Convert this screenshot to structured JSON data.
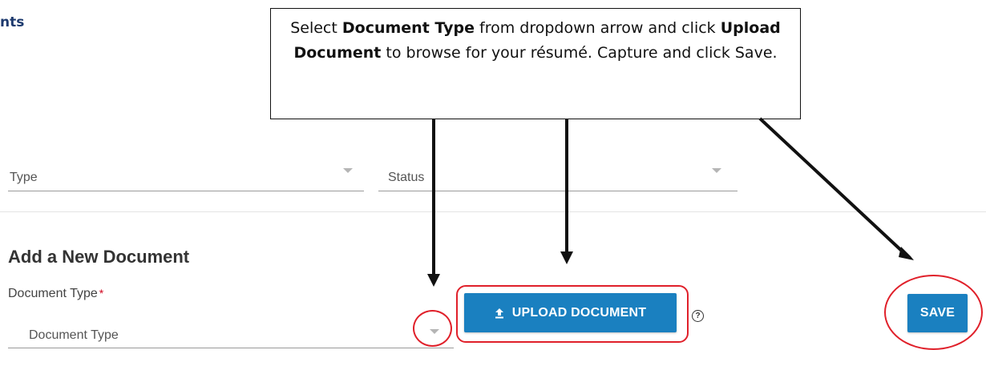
{
  "header": {
    "title_fragment": "nts"
  },
  "filters": {
    "type_label": "Type",
    "status_label": "Status"
  },
  "add_document": {
    "heading": "Add a New Document",
    "doc_type_label": "Document Type",
    "required_marker": "*",
    "doc_type_placeholder": "Document Type",
    "upload_button_label": "UPLOAD DOCUMENT",
    "upload_icon": "upload-icon",
    "help_icon": "help-circle-icon",
    "help_glyph": "?",
    "save_button_label": "SAVE"
  },
  "callout": {
    "part1": "Select ",
    "bold1": "Document Type",
    "part2": " from dropdown arrow and click ",
    "bold2": "Upload Document",
    "part3": " to browse for your résumé. Capture and click Save."
  },
  "colors": {
    "primary_button": "#1a80c0",
    "highlight_red": "#e0202a",
    "header_navy": "#1d3a6e",
    "required_red": "#d0021b"
  }
}
